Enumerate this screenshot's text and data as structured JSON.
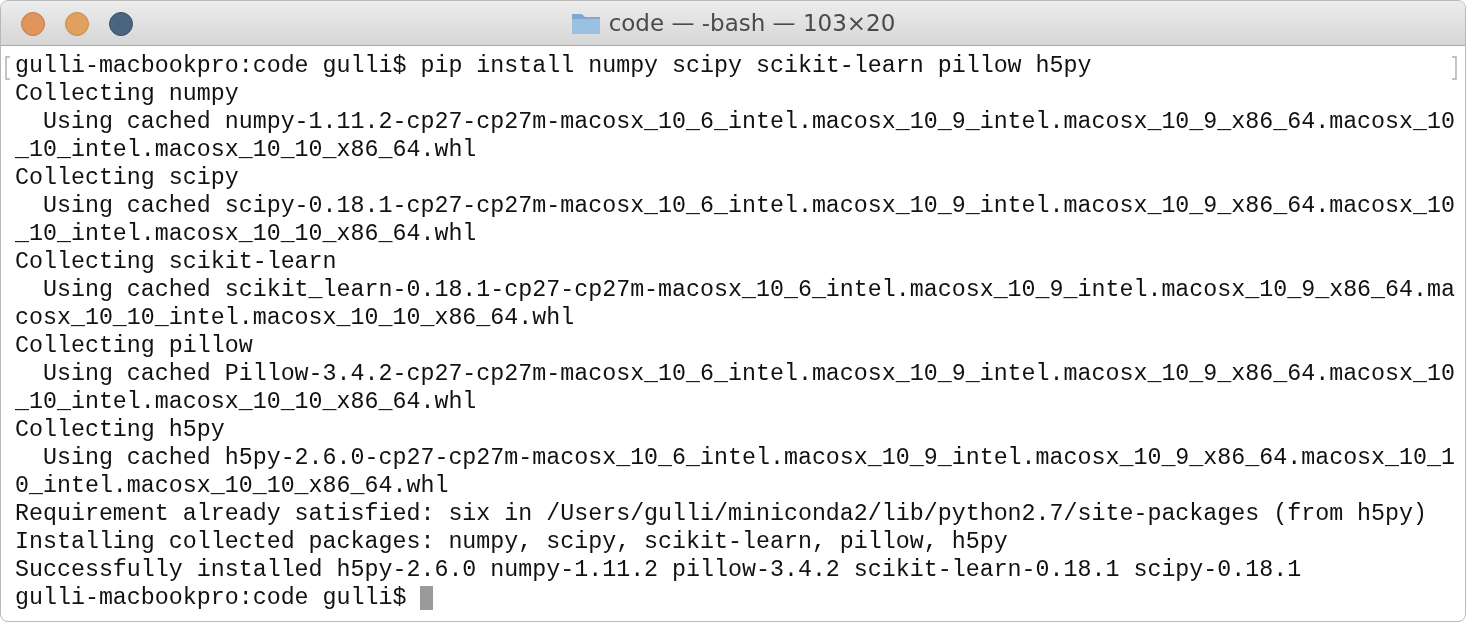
{
  "window": {
    "title": "code — -bash — 103×20"
  },
  "terminal": {
    "lines": [
      "gulli-macbookpro:code gulli$ pip install numpy scipy scikit-learn pillow h5py",
      "Collecting numpy",
      "  Using cached numpy-1.11.2-cp27-cp27m-macosx_10_6_intel.macosx_10_9_intel.macosx_10_9_x86_64.macosx_10",
      "_10_intel.macosx_10_10_x86_64.whl",
      "Collecting scipy",
      "  Using cached scipy-0.18.1-cp27-cp27m-macosx_10_6_intel.macosx_10_9_intel.macosx_10_9_x86_64.macosx_10",
      "_10_intel.macosx_10_10_x86_64.whl",
      "Collecting scikit-learn",
      "  Using cached scikit_learn-0.18.1-cp27-cp27m-macosx_10_6_intel.macosx_10_9_intel.macosx_10_9_x86_64.ma",
      "cosx_10_10_intel.macosx_10_10_x86_64.whl",
      "Collecting pillow",
      "  Using cached Pillow-3.4.2-cp27-cp27m-macosx_10_6_intel.macosx_10_9_intel.macosx_10_9_x86_64.macosx_10",
      "_10_intel.macosx_10_10_x86_64.whl",
      "Collecting h5py",
      "  Using cached h5py-2.6.0-cp27-cp27m-macosx_10_6_intel.macosx_10_9_intel.macosx_10_9_x86_64.macosx_10_1",
      "0_intel.macosx_10_10_x86_64.whl",
      "Requirement already satisfied: six in /Users/gulli/miniconda2/lib/python2.7/site-packages (from h5py)",
      "Installing collected packages: numpy, scipy, scikit-learn, pillow, h5py",
      "Successfully installed h5py-2.6.0 numpy-1.11.2 pillow-3.4.2 scikit-learn-0.18.1 scipy-0.18.1"
    ],
    "prompt": "gulli-macbookpro:code gulli$"
  }
}
